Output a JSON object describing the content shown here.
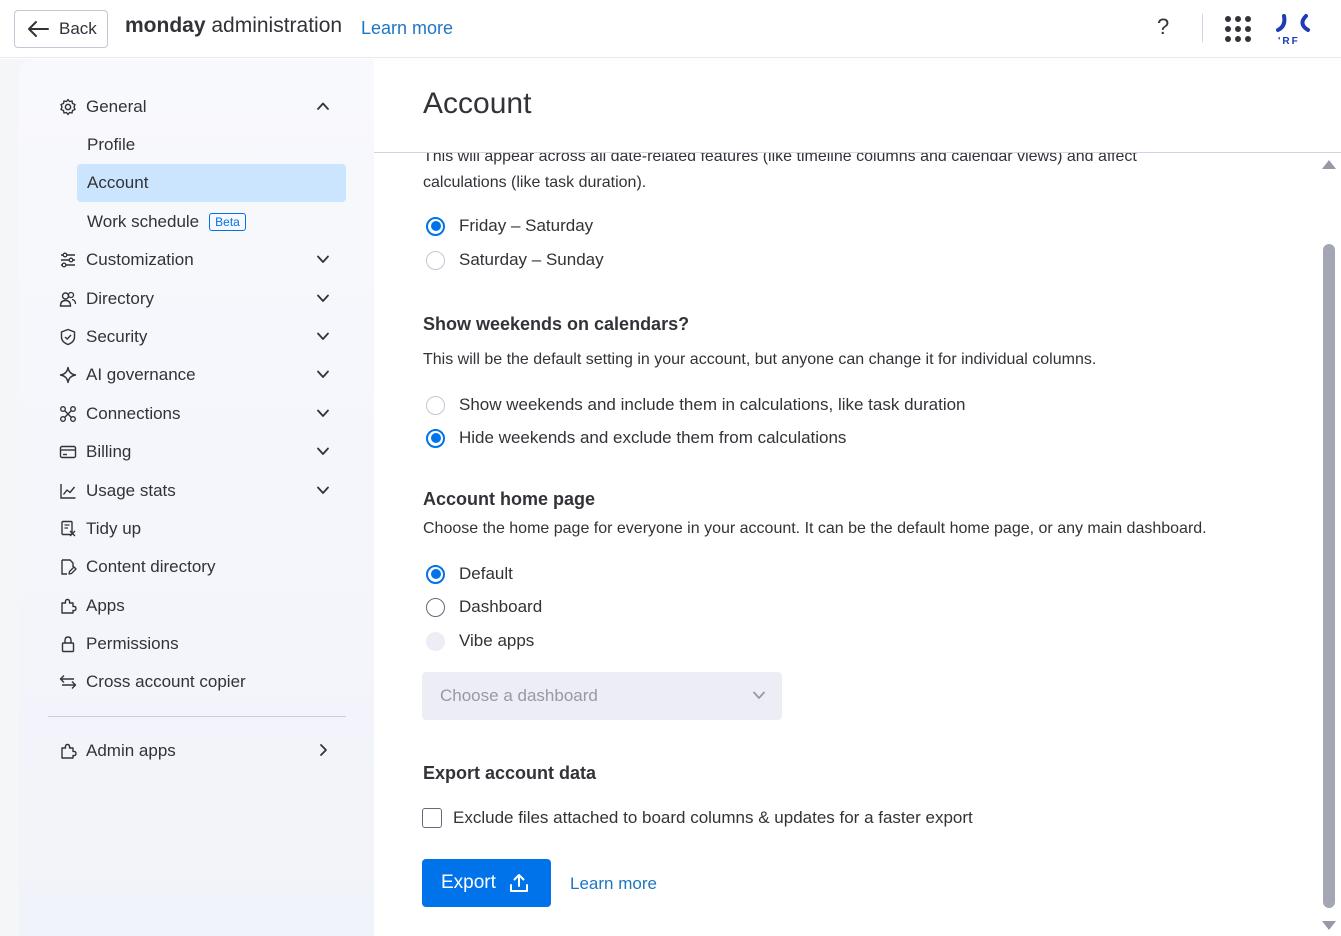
{
  "topbar": {
    "back_label": "Back",
    "brand": "monday",
    "title_rest": " administration",
    "learn_more": "Learn more",
    "help_glyph": "?",
    "avatar_text": "'RF"
  },
  "sidebar": {
    "general": {
      "label": "General",
      "icon": "gear-icon"
    },
    "sub_items": [
      {
        "label": "Profile"
      },
      {
        "label": "Account",
        "active": true
      },
      {
        "label": "Work schedule",
        "badge": "Beta"
      }
    ],
    "items": [
      {
        "label": "Customization",
        "icon": "sliders-icon"
      },
      {
        "label": "Directory",
        "icon": "people-icon"
      },
      {
        "label": "Security",
        "icon": "shield-icon"
      },
      {
        "label": "AI governance",
        "icon": "sparkle-icon"
      },
      {
        "label": "Connections",
        "icon": "connections-icon"
      },
      {
        "label": "Billing",
        "icon": "credit-card-icon"
      },
      {
        "label": "Usage stats",
        "icon": "chart-icon"
      },
      {
        "label": "Tidy up",
        "icon": "tidy-icon"
      },
      {
        "label": "Content directory",
        "icon": "content-icon"
      },
      {
        "label": "Apps",
        "icon": "puzzle-icon"
      },
      {
        "label": "Permissions",
        "icon": "lock-icon"
      },
      {
        "label": "Cross account copier",
        "icon": "swap-icon"
      }
    ],
    "admin_apps": {
      "label": "Admin apps",
      "icon": "puzzle-icon"
    }
  },
  "main": {
    "title": "Account",
    "weekend_days": {
      "desc_line1": "This will appear across all date-related features (like timeline columns and calendar views) and affect",
      "desc_line2": "calculations (like task duration).",
      "options": [
        "Friday – Saturday",
        "Saturday – Sunday"
      ],
      "selected": 0
    },
    "show_weekends": {
      "heading": "Show weekends on calendars?",
      "desc": "This will be the default setting in your account, but anyone can change it for individual columns.",
      "options": [
        "Show weekends and include them in calculations, like task duration",
        "Hide weekends and exclude them from calculations"
      ],
      "selected": 1
    },
    "home_page": {
      "heading": "Account home page",
      "desc": "Choose the home page for everyone in your account. It can be the default home page, or any main dashboard.",
      "options": [
        "Default",
        "Dashboard",
        "Vibe apps"
      ],
      "selected": 0,
      "dropdown_placeholder": "Choose a dashboard"
    },
    "export": {
      "heading": "Export account data",
      "checkbox_label": "Exclude files attached to board columns & updates for a faster export",
      "checkbox_checked": false,
      "button_label": "Export",
      "learn_more": "Learn more"
    }
  },
  "colors": {
    "accent": "#0073ea",
    "link": "#1f76c2",
    "active_nav": "#cce5ff",
    "text": "#323338"
  }
}
